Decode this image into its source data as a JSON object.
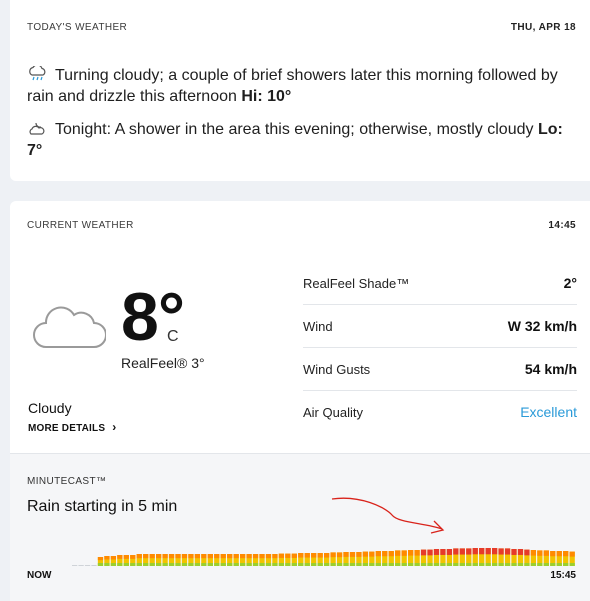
{
  "today": {
    "header": "TODAY'S WEATHER",
    "date": "THU, APR 18",
    "day_text": "Turning cloudy; a couple of brief showers later this morning followed by rain and drizzle this afternoon",
    "hi_label": "Hi: 10°",
    "night_text": "Tonight: A shower in the area this evening; otherwise, mostly cloudy",
    "lo_label": "Lo: 7°",
    "day_icon": "rain-cloud-icon",
    "night_icon": "moon-cloud-icon"
  },
  "current": {
    "header": "CURRENT WEATHER",
    "time": "14:45",
    "temp": "8°",
    "unit": "C",
    "realfeel": "RealFeel® 3°",
    "condition": "Cloudy",
    "more_details": "MORE DETAILS",
    "stats": [
      {
        "label": "RealFeel Shade™",
        "value": "2°"
      },
      {
        "label": "Wind",
        "value": "W 32 km/h"
      },
      {
        "label": "Wind Gusts",
        "value": "54 km/h"
      },
      {
        "label": "Air Quality",
        "value": "Excellent"
      }
    ],
    "air_quality_color": "#2a9ad8"
  },
  "minutecast": {
    "header": "MINUTECAST™",
    "message": "Rain starting in 5 min",
    "start_label": "NOW",
    "end_label": "15:45",
    "precip_levels": [
      0,
      0,
      0,
      0,
      0.45,
      0.5,
      0.5,
      0.55,
      0.55,
      0.55,
      0.6,
      0.6,
      0.6,
      0.6,
      0.6,
      0.6,
      0.6,
      0.6,
      0.6,
      0.6,
      0.6,
      0.6,
      0.6,
      0.6,
      0.6,
      0.6,
      0.6,
      0.6,
      0.6,
      0.6,
      0.6,
      0.6,
      0.62,
      0.62,
      0.62,
      0.65,
      0.65,
      0.65,
      0.65,
      0.65,
      0.68,
      0.68,
      0.7,
      0.7,
      0.7,
      0.72,
      0.72,
      0.75,
      0.75,
      0.75,
      0.78,
      0.78,
      0.8,
      0.8,
      0.82,
      0.82,
      0.85,
      0.85,
      0.85,
      0.88,
      0.88,
      0.88,
      0.9,
      0.9,
      0.9,
      0.9,
      0.88,
      0.88,
      0.85,
      0.85,
      0.82,
      0.8,
      0.78,
      0.78,
      0.75,
      0.75,
      0.75,
      0.72
    ],
    "color_low": "#f2c300",
    "color_mid": "#ff8a00",
    "color_high": "#e63a2a",
    "color_base": "#9bcf2e",
    "annotation_color": "#d9231b"
  }
}
